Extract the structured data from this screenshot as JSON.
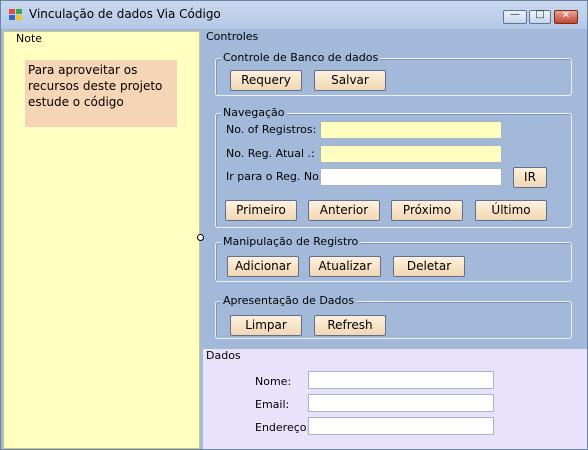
{
  "window": {
    "title": "Vinculação de dados Via Código"
  },
  "titlebar": {
    "minimize_glyph": "—",
    "maximize_glyph": "□",
    "close_glyph": "✕"
  },
  "note": {
    "title": "Note",
    "text": "Para aproveitar os recursos deste projeto estude o código"
  },
  "controles": {
    "label": "Controles",
    "banco": {
      "label": "Controle de Banco de dados",
      "requery": "Requery",
      "salvar": "Salvar"
    },
    "navegacao": {
      "label": "Navegação",
      "num_registros_label": "No. of Registros:",
      "num_reg_atual_label": "No. Reg. Atual .:",
      "ir_para_label": "Ir para o Reg. No.",
      "num_registros_value": "",
      "num_reg_atual_value": "",
      "ir_para_value": "",
      "ir_button": "IR",
      "primeiro": "Primeiro",
      "anterior": "Anterior",
      "proximo": "Próximo",
      "ultimo": "Último"
    },
    "manipulacao": {
      "label": "Manipulação de Registro",
      "adicionar": "Adicionar",
      "atualizar": "Atualizar",
      "deletar": "Deletar"
    },
    "apresentacao": {
      "label": "Apresentação de Dados",
      "limpar": "Limpar",
      "refresh": "Refresh"
    }
  },
  "dados": {
    "label": "Dados",
    "nome_label": "Nome:",
    "email_label": "Email:",
    "endereco_label": "Endereço:",
    "nome_value": "",
    "email_value": "",
    "endereco_value": ""
  },
  "colors": {
    "window_bg": "#a3b9d9",
    "note_bg": "#ffffc0",
    "note_text_bg": "#f6d4b6",
    "dados_bg": "#e8e3fb",
    "button_bg": "#f1d6b2"
  }
}
